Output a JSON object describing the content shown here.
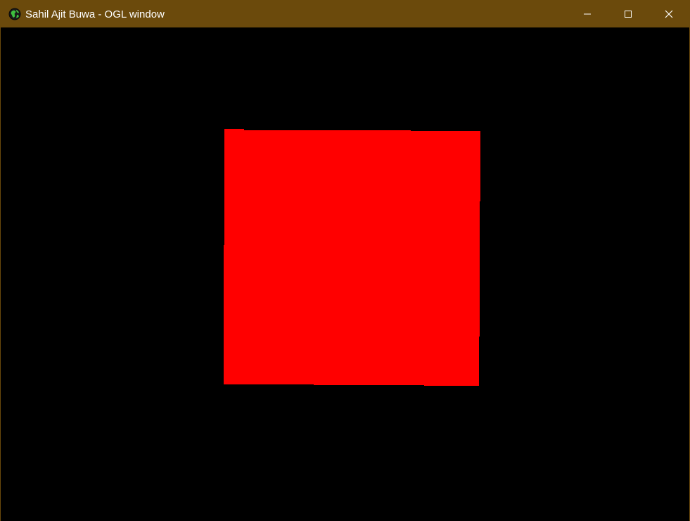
{
  "window": {
    "title": "Sahil Ajit Buwa - OGL window",
    "icon": "globe-app-icon",
    "controls": [
      "minimize-icon",
      "maximize-icon",
      "close-icon"
    ],
    "titlebar_color": "#6b4a0c",
    "background_color": "#000000"
  },
  "scene": {
    "shape": "square",
    "fill_color": "#ff0000"
  }
}
